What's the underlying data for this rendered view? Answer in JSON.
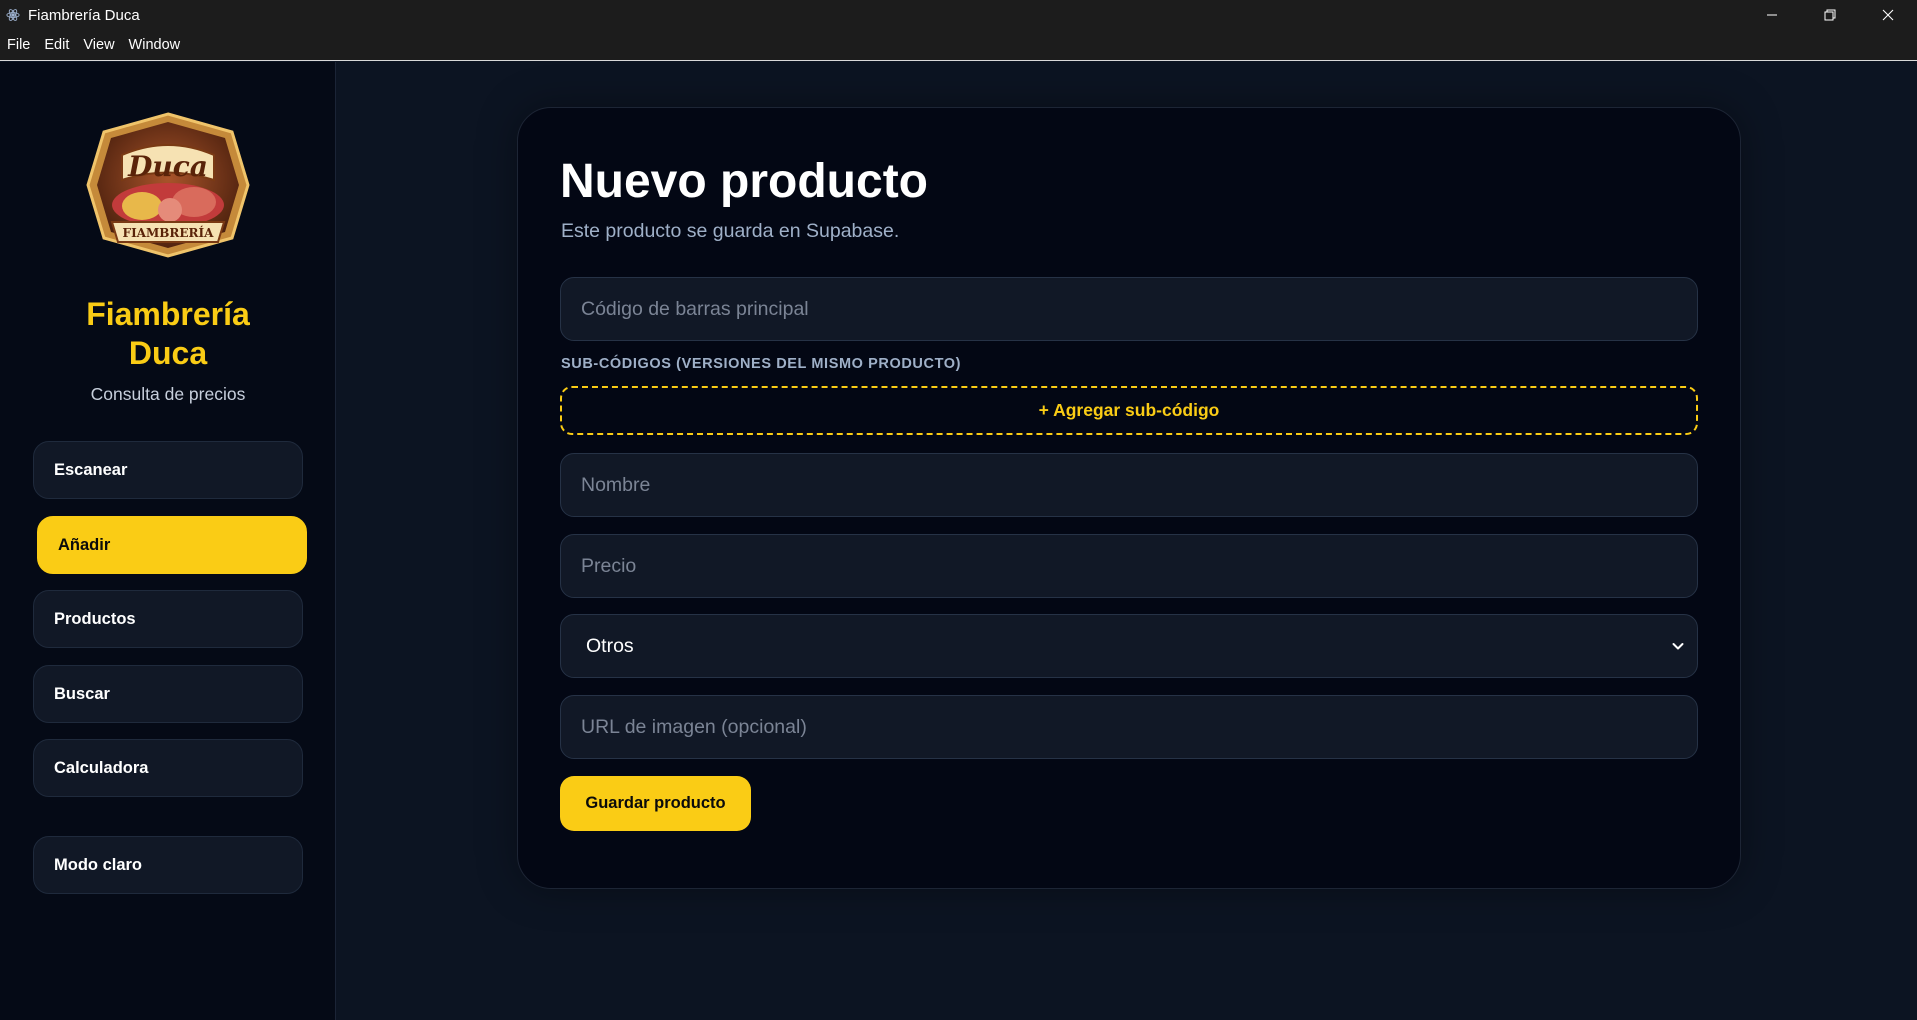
{
  "window": {
    "title": "Fiambrería Duca"
  },
  "menu": [
    "File",
    "Edit",
    "View",
    "Window"
  ],
  "sidebar": {
    "brand_name": "Fiambrería Duca",
    "brand_subtitle": "Consulta de precios",
    "logo": {
      "text": "Duca",
      "banner": "FIAMBRERÍA"
    },
    "nav": [
      {
        "label": "Escanear",
        "active": false
      },
      {
        "label": "Añadir",
        "active": true
      },
      {
        "label": "Productos",
        "active": false
      },
      {
        "label": "Buscar",
        "active": false
      },
      {
        "label": "Calculadora",
        "active": false
      }
    ],
    "theme_toggle": "Modo claro"
  },
  "form": {
    "title": "Nuevo producto",
    "subtitle": "Este producto se guarda en Supabase.",
    "barcode_placeholder": "Código de barras principal",
    "subcodes_label": "SUB-CÓDIGOS (VERSIONES DEL MISMO PRODUCTO)",
    "add_subcode": "+ Agregar sub-código",
    "name_placeholder": "Nombre",
    "price_placeholder": "Precio",
    "category_selected": "Otros",
    "image_url_placeholder": "URL de imagen (opcional)",
    "save_label": "Guardar producto"
  },
  "colors": {
    "accent": "#facc15",
    "background": "#0c1422",
    "sidebar": "#050a16",
    "card": "#030714",
    "field": "#111826"
  }
}
